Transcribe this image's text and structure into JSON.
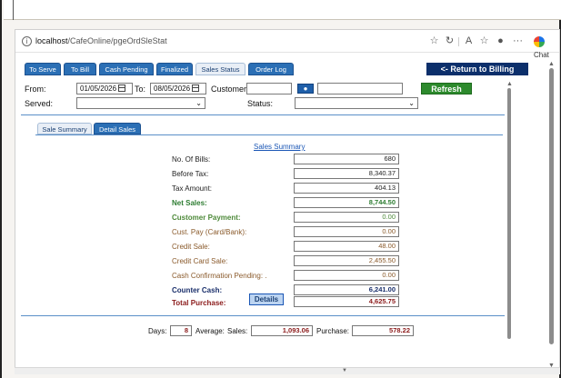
{
  "browser": {
    "url_host": "localhost",
    "url_path": "/CafeOnline/pgeOrdSleStat",
    "chat_label": "Chat"
  },
  "tabs": [
    {
      "label": "To Serve"
    },
    {
      "label": "To Bill"
    },
    {
      "label": "Cash Pending"
    },
    {
      "label": "Finalized"
    },
    {
      "label": "Sales Status"
    },
    {
      "label": "Order Log"
    }
  ],
  "return_button": "<- Return to Billing",
  "filters": {
    "from_label": "From:",
    "from_value": "01/05/2026",
    "to_label": "To:",
    "to_value": "08/05/2026",
    "customer_label": "Customer:",
    "customer_value": "",
    "customer_name_value": "",
    "served_label": "Served:",
    "served_value": "",
    "status_label": "Status:",
    "status_value": "",
    "refresh_label": "Refresh"
  },
  "subtabs": [
    {
      "label": "Sale Summary"
    },
    {
      "label": "Detail Sales"
    }
  ],
  "summary": {
    "title": "Sales Summary",
    "rows": [
      {
        "label": "No. Of Bills:",
        "value": "680"
      },
      {
        "label": "Before Tax:",
        "value": "8,340.37"
      },
      {
        "label": "Tax Amount:",
        "value": "404.13"
      },
      {
        "label": "Net Sales:",
        "value": "8,744.50"
      },
      {
        "label": "Customer Payment:",
        "value": "0.00"
      },
      {
        "label": "Cust. Pay (Card/Bank):",
        "value": "0.00"
      },
      {
        "label": "Credit Sale:",
        "value": "48.00"
      },
      {
        "label": "Credit Card Sale:",
        "value": "2,455.50"
      },
      {
        "label": "Cash Confirmation Pending: .",
        "value": "0.00"
      },
      {
        "label": "Counter Cash:",
        "value": "6,241.00"
      },
      {
        "label": "Total Purchase:",
        "value": "4,625.75"
      }
    ],
    "details_label": "Details"
  },
  "bottom": {
    "days_label": "Days:",
    "days_value": "8",
    "average_label": "Average:",
    "sales_label": "Sales:",
    "sales_value": "1,093.06",
    "purchase_label": "Purchase:",
    "purchase_value": "578.22"
  },
  "colors": {
    "tab_blue": "#2b6fb5",
    "return_navy": "#0c2f6b",
    "refresh_green": "#2d8a2d",
    "net_sales_green": "#2e7d32",
    "customer_payment_green": "#4e8a3a",
    "credit_brown": "#8a5a2b",
    "counter_cash_navy": "#1a2f6b",
    "total_purchase_red": "#8b1a1a"
  }
}
